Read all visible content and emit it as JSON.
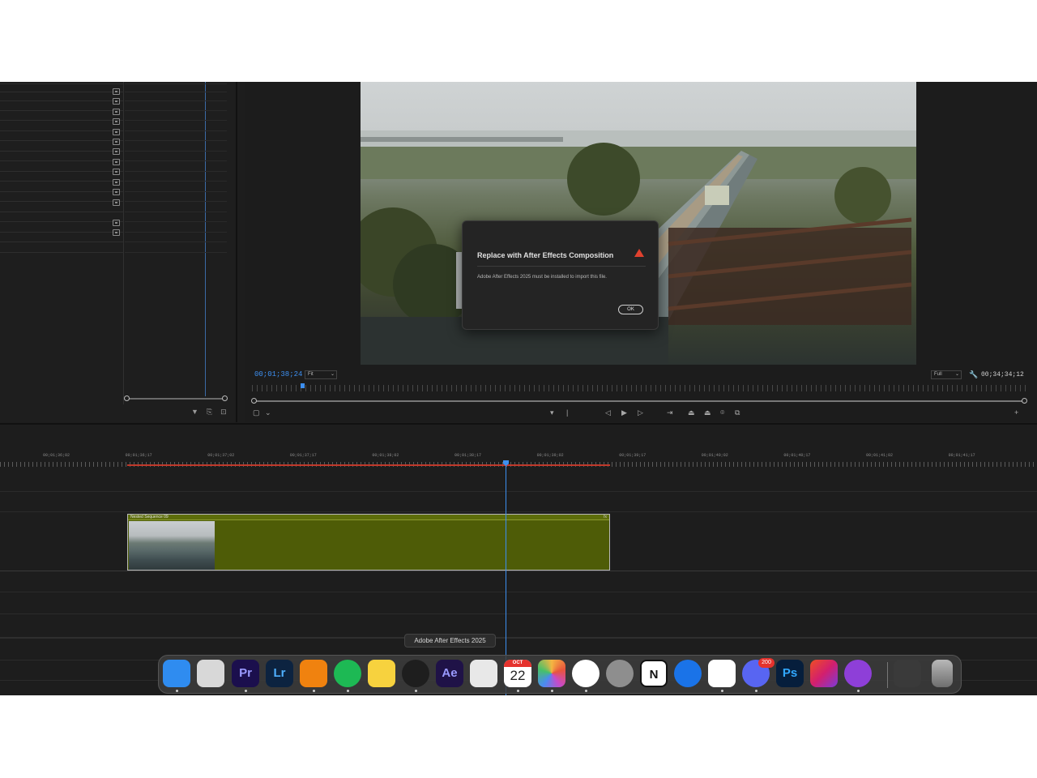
{
  "monitor": {
    "timecode_current": "00;01;38;24",
    "fit_label": "Fit",
    "resolution_label": "Full",
    "timecode_duration": "00;34;34;12"
  },
  "dialog": {
    "title": "Replace with After Effects Composition",
    "message": "Adobe After Effects 2025 must be installed to import this file.",
    "ok_label": "OK"
  },
  "timeline": {
    "ruler_labels": [
      "00;01;36;02",
      "00;01;36;17",
      "00;01;37;02",
      "00;01;37;17",
      "00;01;38;02",
      "00;01;38;17",
      "00;01;39;02",
      "00;01;39;17",
      "00;01;40;02",
      "00;01;40;17",
      "00;01;41;02",
      "00;01;41;17"
    ],
    "clip_name": "Nested Sequence 09",
    "clip_fx": "fx"
  },
  "dock": {
    "tooltip": "Adobe After Effects 2025",
    "calendar_month": "OCT",
    "calendar_day": "22",
    "discord_badge": "200",
    "apps": [
      {
        "name": "finder-icon",
        "label": "",
        "color": "#2f8cf0"
      },
      {
        "name": "launchpad-icon",
        "label": "",
        "color": "#d8d8d8"
      },
      {
        "name": "premiere-pro-icon",
        "label": "Pr",
        "color": "#1b0f4d"
      },
      {
        "name": "lightroom-icon",
        "label": "Lr",
        "color": "#0c2340"
      },
      {
        "name": "fl-studio-icon",
        "label": "",
        "color": "#f0820f"
      },
      {
        "name": "spotify-icon",
        "label": "",
        "color": "#1db954"
      },
      {
        "name": "notes-icon",
        "label": "",
        "color": "#f7d23e"
      },
      {
        "name": "quicktime-icon",
        "label": "",
        "color": "#1e1e1e"
      },
      {
        "name": "after-effects-icon",
        "label": "Ae",
        "color": "#1f1247"
      },
      {
        "name": "screenshot-icon",
        "label": "",
        "color": "#e8e8e8"
      },
      {
        "name": "calendar-icon",
        "label": "",
        "color": "#ffffff"
      },
      {
        "name": "photos-icon",
        "label": "",
        "color": "#f5b642"
      },
      {
        "name": "chrome-icon",
        "label": "",
        "color": "#ffffff"
      },
      {
        "name": "system-settings-icon",
        "label": "",
        "color": "#8e8e8e"
      },
      {
        "name": "notion-icon",
        "label": "N",
        "color": "#ffffff"
      },
      {
        "name": "1password-icon",
        "label": "",
        "color": "#1a73e8"
      },
      {
        "name": "slack-icon",
        "label": "",
        "color": "#ffffff"
      },
      {
        "name": "discord-icon",
        "label": "",
        "color": "#5865f2"
      },
      {
        "name": "photoshop-icon",
        "label": "Ps",
        "color": "#061e3c"
      },
      {
        "name": "creative-cloud-icon",
        "label": "",
        "color": "#da1f26"
      },
      {
        "name": "podcasts-icon",
        "label": "",
        "color": "#8e3fd8"
      },
      {
        "name": "downloads-stack-icon",
        "label": "",
        "color": "#3a3a3a"
      },
      {
        "name": "trash-icon",
        "label": "",
        "color": "#9a9a9a"
      }
    ]
  }
}
